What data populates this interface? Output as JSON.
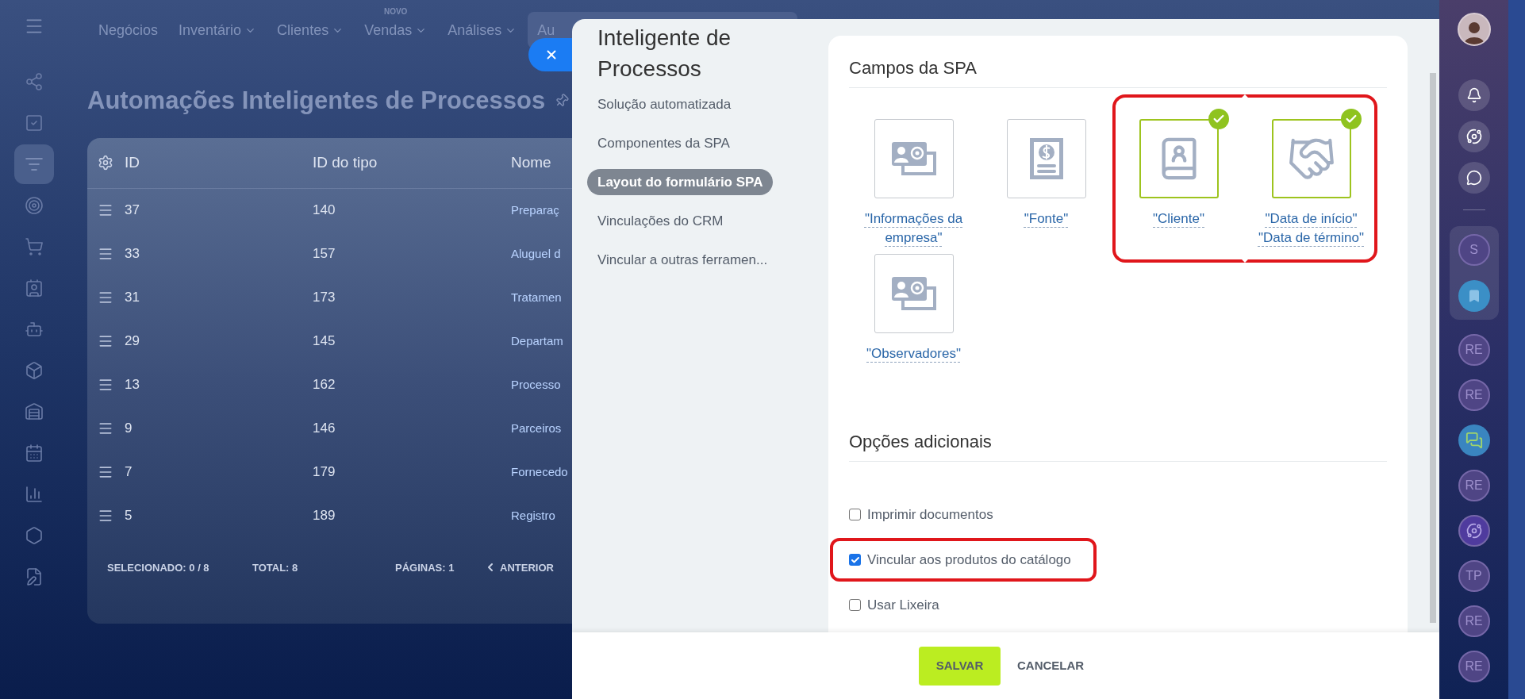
{
  "sidebar": {
    "items": [
      {
        "selected": false
      },
      {
        "selected": false
      },
      {
        "selected": true
      },
      {
        "selected": false
      },
      {
        "selected": false
      },
      {
        "selected": false
      },
      {
        "selected": false
      },
      {
        "selected": false
      },
      {
        "selected": false
      },
      {
        "selected": false
      },
      {
        "selected": false
      },
      {
        "selected": false
      },
      {
        "selected": false
      }
    ]
  },
  "top_nav": {
    "items": [
      {
        "label": "Negócios",
        "dropdown": false,
        "selected": false
      },
      {
        "label": "Inventário",
        "dropdown": true,
        "selected": false
      },
      {
        "label": "Clientes",
        "dropdown": true,
        "selected": false
      },
      {
        "label": "Vendas",
        "dropdown": true,
        "selected": false,
        "badge": "NOVO"
      },
      {
        "label": "Análises",
        "dropdown": true,
        "selected": false
      },
      {
        "label": "Au",
        "dropdown": false,
        "selected": true
      }
    ]
  },
  "page": {
    "title": "Automações Inteligentes de Processos"
  },
  "table": {
    "columns": [
      "ID",
      "ID do tipo",
      "Nome"
    ],
    "rows": [
      {
        "id": "37",
        "type_id": "140",
        "name": "Preparaç"
      },
      {
        "id": "33",
        "type_id": "157",
        "name": "Aluguel d"
      },
      {
        "id": "31",
        "type_id": "173",
        "name": "Tratamen"
      },
      {
        "id": "29",
        "type_id": "145",
        "name": "Departam"
      },
      {
        "id": "13",
        "type_id": "162",
        "name": "Processo"
      },
      {
        "id": "9",
        "type_id": "146",
        "name": "Parceiros"
      },
      {
        "id": "7",
        "type_id": "179",
        "name": "Fornecedo"
      },
      {
        "id": "5",
        "type_id": "189",
        "name": "Registro"
      }
    ],
    "footer": {
      "selected_label": "SELECIONADO:",
      "selected_value": "0 / 8",
      "total_label": "TOTAL:",
      "total_value": "8",
      "pages_label": "PÁGINAS:",
      "pages_value": "1",
      "prev": "ANTERIOR"
    }
  },
  "panel": {
    "title": "Inteligente de Processos",
    "nav": [
      {
        "label": "Solução automatizada",
        "selected": false
      },
      {
        "label": "Componentes da SPA",
        "selected": false
      },
      {
        "label": "Layout do formulário SPA",
        "selected": true
      },
      {
        "label": "Vinculações do CRM",
        "selected": false
      },
      {
        "label": "Vincular a outras ferramen...",
        "selected": false
      }
    ],
    "fields_section": {
      "title": "Campos da SPA",
      "fields": [
        {
          "kind": "contact",
          "labels": [
            "\"Informações da empresa\""
          ],
          "checked": false,
          "highlighted": false
        },
        {
          "kind": "invoice",
          "labels": [
            "\"Fonte\""
          ],
          "checked": false,
          "highlighted": false
        },
        {
          "kind": "addressbook",
          "labels": [
            "\"Cliente\""
          ],
          "checked": true,
          "highlighted": true
        },
        {
          "kind": "handshake",
          "labels": [
            "\"Data de início\"",
            "\"Data de término\""
          ],
          "checked": true,
          "highlighted": true
        },
        {
          "kind": "contact",
          "labels": [
            "\"Observadores\""
          ],
          "checked": false,
          "highlighted": false
        }
      ]
    },
    "options_section": {
      "title": "Opções adicionais",
      "items": [
        {
          "label": "Imprimir documentos",
          "checked": false,
          "highlighted": false
        },
        {
          "label": "Vincular aos produtos do catálogo",
          "checked": true,
          "highlighted": true
        },
        {
          "label": "Usar Lixeira",
          "checked": false,
          "highlighted": false
        }
      ]
    },
    "buttons": {
      "save": "SALVAR",
      "cancel": "CANCELAR"
    }
  },
  "right_rail": {
    "avatars": [
      {
        "kind": "initials",
        "text": "S",
        "grouped": true
      },
      {
        "kind": "bookmark",
        "grouped": true
      },
      {
        "kind": "initials",
        "text": "RE",
        "grouped": false
      },
      {
        "kind": "initials",
        "text": "RE",
        "grouped": false
      },
      {
        "kind": "chat",
        "grouped": false
      },
      {
        "kind": "initials",
        "text": "RE",
        "grouped": false
      },
      {
        "kind": "spiral",
        "grouped": false
      },
      {
        "kind": "initials",
        "text": "TP",
        "grouped": false
      },
      {
        "kind": "initials",
        "text": "RE",
        "grouped": false
      },
      {
        "kind": "initials",
        "text": "RE",
        "grouped": false
      }
    ]
  }
}
